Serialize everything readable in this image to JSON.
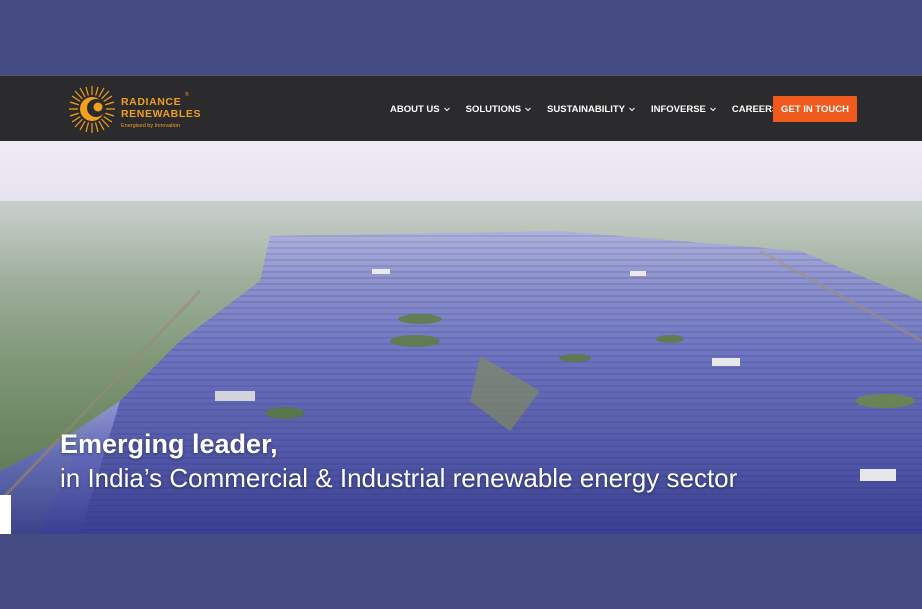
{
  "logo": {
    "line1": "RADIANCE",
    "line2": "RENEWABLES",
    "reg_mark": "®",
    "tagline": "Energised by Innovation"
  },
  "nav": {
    "items": [
      {
        "label": "ABOUT US",
        "dropdown": true
      },
      {
        "label": "SOLUTIONS",
        "dropdown": true
      },
      {
        "label": "SUSTAINABILITY",
        "dropdown": true
      },
      {
        "label": "INFOVERSE",
        "dropdown": true
      },
      {
        "label": "CAREERS",
        "dropdown": false
      }
    ],
    "cta_label": "GET IN TOUCH"
  },
  "hero": {
    "headline": "Emerging leader,",
    "subline": "in India’s Commercial & Industrial renewable energy sector"
  },
  "colors": {
    "frame": "#454b83",
    "navbar": "#2b2b2d",
    "brand_orange": "#f29f1f",
    "cta": "#f15a1f"
  }
}
